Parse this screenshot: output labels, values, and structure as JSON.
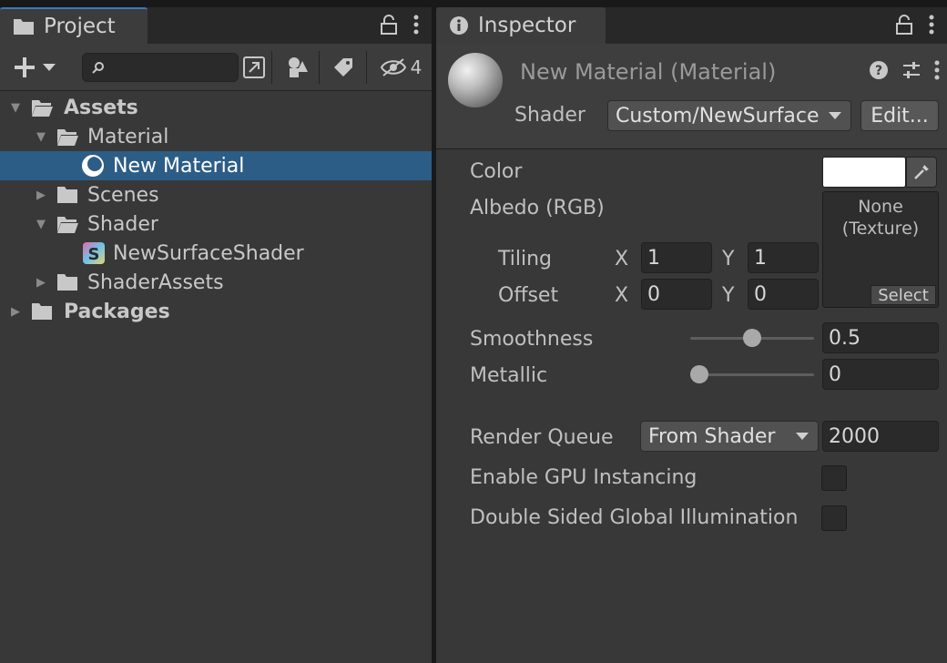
{
  "project": {
    "tab_label": "Project",
    "search": {
      "placeholder": ""
    },
    "hidden_count": "4",
    "tree": [
      {
        "label": "Assets",
        "bold": true,
        "expanded": true,
        "depth": 0,
        "icon": "folder-open-icon"
      },
      {
        "label": "Material",
        "bold": false,
        "expanded": true,
        "depth": 1,
        "icon": "folder-open-icon"
      },
      {
        "label": "New Material",
        "bold": false,
        "selected": true,
        "depth": 2,
        "icon": "material-icon"
      },
      {
        "label": "Scenes",
        "bold": false,
        "expanded": false,
        "depth": 1,
        "icon": "folder-icon"
      },
      {
        "label": "Shader",
        "bold": false,
        "expanded": true,
        "depth": 1,
        "icon": "folder-open-icon"
      },
      {
        "label": "NewSurfaceShader",
        "bold": false,
        "depth": 2,
        "icon": "shader-icon"
      },
      {
        "label": "ShaderAssets",
        "bold": false,
        "expanded": false,
        "depth": 1,
        "icon": "folder-icon"
      },
      {
        "label": "Packages",
        "bold": true,
        "expanded": false,
        "depth": 0,
        "icon": "folder-icon"
      }
    ]
  },
  "inspector": {
    "tab_label": "Inspector",
    "material_name": "New Material (Material)",
    "shader_label": "Shader",
    "shader_value": "Custom/NewSurface",
    "edit_button": "Edit...",
    "properties": {
      "color_label": "Color",
      "color_value": "#ffffff",
      "albedo_label": "Albedo (RGB)",
      "texture_none": "None",
      "texture_type": "(Texture)",
      "texture_select": "Select",
      "tiling_label": "Tiling",
      "offset_label": "Offset",
      "x_label": "X",
      "y_label": "Y",
      "tiling_x": "1",
      "tiling_y": "1",
      "offset_x": "0",
      "offset_y": "0",
      "smoothness_label": "Smoothness",
      "smoothness_value": "0.5",
      "metallic_label": "Metallic",
      "metallic_value": "0",
      "render_queue_label": "Render Queue",
      "render_queue_mode": "From Shader",
      "render_queue_value": "2000",
      "gpu_instancing_label": "Enable GPU Instancing",
      "gpu_instancing_checked": false,
      "double_sided_gi_label": "Double Sided Global Illumination",
      "double_sided_gi_checked": false
    }
  },
  "colors": {
    "selection": "#2c5d87",
    "panel_bg": "#383838",
    "tab_accent": "#3a79bb"
  }
}
